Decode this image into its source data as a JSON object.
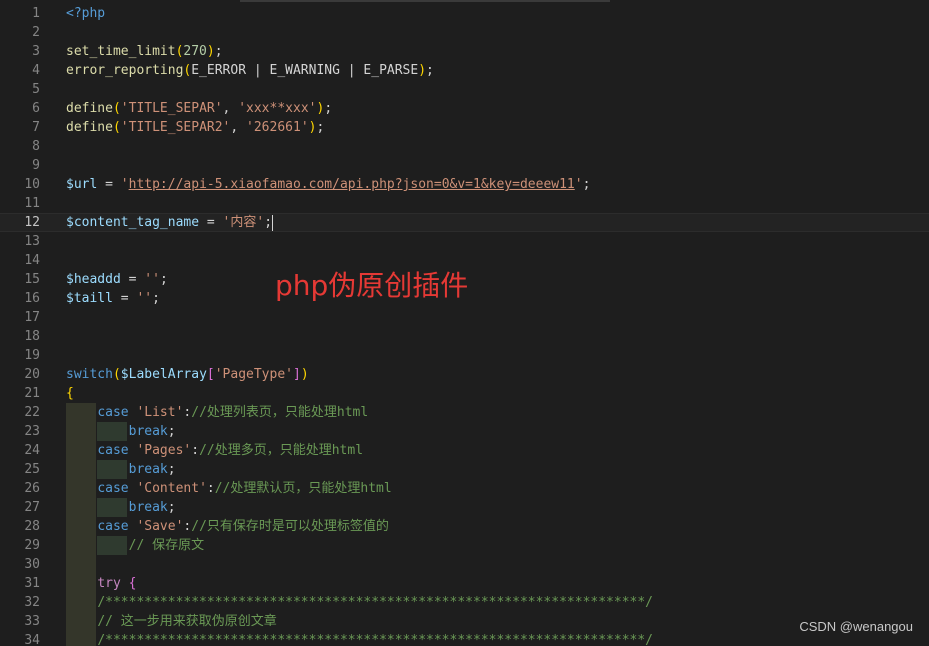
{
  "editor": {
    "current_line": 12,
    "lines": [
      {
        "n": "1",
        "tokens": [
          {
            "t": "<?php",
            "c": "kw"
          }
        ]
      },
      {
        "n": "2",
        "tokens": []
      },
      {
        "n": "3",
        "tokens": [
          {
            "t": "set_time_limit",
            "c": "fn"
          },
          {
            "t": "(",
            "c": "b1"
          },
          {
            "t": "270",
            "c": "num"
          },
          {
            "t": ")",
            "c": "b1"
          },
          {
            "t": ";",
            "c": "pl"
          }
        ]
      },
      {
        "n": "4",
        "tokens": [
          {
            "t": "error_reporting",
            "c": "fn"
          },
          {
            "t": "(",
            "c": "b1"
          },
          {
            "t": "E_ERROR | E_WARNING | E_PARSE",
            "c": "pl"
          },
          {
            "t": ")",
            "c": "b1"
          },
          {
            "t": ";",
            "c": "pl"
          }
        ]
      },
      {
        "n": "5",
        "tokens": []
      },
      {
        "n": "6",
        "tokens": [
          {
            "t": "define",
            "c": "fn"
          },
          {
            "t": "(",
            "c": "b1"
          },
          {
            "t": "'TITLE_SEPAR'",
            "c": "str"
          },
          {
            "t": ", ",
            "c": "pl"
          },
          {
            "t": "'xxx**xxx'",
            "c": "str"
          },
          {
            "t": ")",
            "c": "b1"
          },
          {
            "t": ";",
            "c": "pl"
          }
        ]
      },
      {
        "n": "7",
        "tokens": [
          {
            "t": "define",
            "c": "fn"
          },
          {
            "t": "(",
            "c": "b1"
          },
          {
            "t": "'TITLE_SEPAR2'",
            "c": "str"
          },
          {
            "t": ", ",
            "c": "pl"
          },
          {
            "t": "'262661'",
            "c": "str"
          },
          {
            "t": ")",
            "c": "b1"
          },
          {
            "t": ";",
            "c": "pl"
          }
        ]
      },
      {
        "n": "8",
        "tokens": []
      },
      {
        "n": "9",
        "tokens": []
      },
      {
        "n": "10",
        "tokens": [
          {
            "t": "$url",
            "c": "var"
          },
          {
            "t": " = ",
            "c": "pl"
          },
          {
            "t": "'",
            "c": "str"
          },
          {
            "t": "http://api-5.xiaofamao.com/api.php?json=0&v=1&key=deeew11",
            "c": "url"
          },
          {
            "t": "'",
            "c": "str"
          },
          {
            "t": ";",
            "c": "pl"
          }
        ]
      },
      {
        "n": "11",
        "tokens": []
      },
      {
        "n": "12",
        "tokens": [
          {
            "t": "$content_tag_name",
            "c": "var"
          },
          {
            "t": " = ",
            "c": "pl"
          },
          {
            "t": "'内容'",
            "c": "str"
          },
          {
            "t": ";",
            "c": "pl"
          }
        ]
      },
      {
        "n": "13",
        "tokens": []
      },
      {
        "n": "14",
        "tokens": []
      },
      {
        "n": "15",
        "tokens": [
          {
            "t": "$headdd",
            "c": "var"
          },
          {
            "t": " = ",
            "c": "pl"
          },
          {
            "t": "''",
            "c": "str"
          },
          {
            "t": ";",
            "c": "pl"
          }
        ]
      },
      {
        "n": "16",
        "tokens": [
          {
            "t": "$taill",
            "c": "var"
          },
          {
            "t": " = ",
            "c": "pl"
          },
          {
            "t": "''",
            "c": "str"
          },
          {
            "t": ";",
            "c": "pl"
          }
        ]
      },
      {
        "n": "17",
        "tokens": []
      },
      {
        "n": "18",
        "tokens": []
      },
      {
        "n": "19",
        "tokens": []
      },
      {
        "n": "20",
        "tokens": [
          {
            "t": "switch",
            "c": "kw"
          },
          {
            "t": "(",
            "c": "b1"
          },
          {
            "t": "$LabelArray",
            "c": "var"
          },
          {
            "t": "[",
            "c": "b2"
          },
          {
            "t": "'PageType'",
            "c": "str"
          },
          {
            "t": "]",
            "c": "b2"
          },
          {
            "t": ")",
            "c": "b1"
          }
        ]
      },
      {
        "n": "21",
        "tokens": [
          {
            "t": "{",
            "c": "b1"
          }
        ]
      },
      {
        "n": "22",
        "tokens": [
          {
            "t": "    ",
            "c": "pl"
          },
          {
            "t": "case",
            "c": "kw"
          },
          {
            "t": " ",
            "c": "pl"
          },
          {
            "t": "'List'",
            "c": "str"
          },
          {
            "t": ":",
            "c": "pl"
          },
          {
            "t": "//处理列表页，只能处理html",
            "c": "cmt"
          }
        ]
      },
      {
        "n": "23",
        "tokens": [
          {
            "t": "        ",
            "c": "pl"
          },
          {
            "t": "break",
            "c": "kw"
          },
          {
            "t": ";",
            "c": "pl"
          }
        ]
      },
      {
        "n": "24",
        "tokens": [
          {
            "t": "    ",
            "c": "pl"
          },
          {
            "t": "case",
            "c": "kw"
          },
          {
            "t": " ",
            "c": "pl"
          },
          {
            "t": "'Pages'",
            "c": "str"
          },
          {
            "t": ":",
            "c": "pl"
          },
          {
            "t": "//处理多页，只能处理html",
            "c": "cmt"
          }
        ]
      },
      {
        "n": "25",
        "tokens": [
          {
            "t": "        ",
            "c": "pl"
          },
          {
            "t": "break",
            "c": "kw"
          },
          {
            "t": ";",
            "c": "pl"
          }
        ]
      },
      {
        "n": "26",
        "tokens": [
          {
            "t": "    ",
            "c": "pl"
          },
          {
            "t": "case",
            "c": "kw"
          },
          {
            "t": " ",
            "c": "pl"
          },
          {
            "t": "'Content'",
            "c": "str"
          },
          {
            "t": ":",
            "c": "pl"
          },
          {
            "t": "//处理默认页，只能处理html",
            "c": "cmt"
          }
        ]
      },
      {
        "n": "27",
        "tokens": [
          {
            "t": "        ",
            "c": "pl"
          },
          {
            "t": "break",
            "c": "kw"
          },
          {
            "t": ";",
            "c": "pl"
          }
        ]
      },
      {
        "n": "28",
        "tokens": [
          {
            "t": "    ",
            "c": "pl"
          },
          {
            "t": "case",
            "c": "kw"
          },
          {
            "t": " ",
            "c": "pl"
          },
          {
            "t": "'Save'",
            "c": "str"
          },
          {
            "t": ":",
            "c": "pl"
          },
          {
            "t": "//只有保存时是可以处理标签值的",
            "c": "cmt"
          }
        ]
      },
      {
        "n": "29",
        "tokens": [
          {
            "t": "        ",
            "c": "pl"
          },
          {
            "t": "// 保存原文",
            "c": "cmt"
          }
        ]
      },
      {
        "n": "30",
        "tokens": []
      },
      {
        "n": "31",
        "tokens": [
          {
            "t": "    ",
            "c": "pl"
          },
          {
            "t": "try",
            "c": "ctl"
          },
          {
            "t": " ",
            "c": "pl"
          },
          {
            "t": "{",
            "c": "b2"
          }
        ]
      },
      {
        "n": "32",
        "tokens": [
          {
            "t": "    ",
            "c": "pl"
          },
          {
            "t": "/*********************************************************************/",
            "c": "cmt"
          }
        ]
      },
      {
        "n": "33",
        "tokens": [
          {
            "t": "    ",
            "c": "pl"
          },
          {
            "t": "// 这一步用来获取伪原创文章",
            "c": "cmt"
          }
        ]
      },
      {
        "n": "34",
        "tokens": [
          {
            "t": "    ",
            "c": "pl"
          },
          {
            "t": "/*********************************************************************/",
            "c": "cmt"
          }
        ]
      }
    ]
  },
  "overlay_title": "php伪原创插件",
  "watermark": "CSDN @wenangou"
}
